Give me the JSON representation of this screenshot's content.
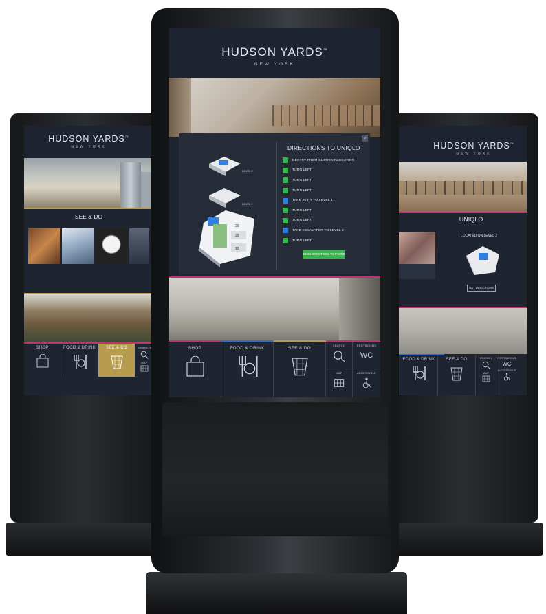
{
  "brand": {
    "title": "HUDSON YARDS",
    "trademark": "™",
    "subtitle": "NEW YORK"
  },
  "left_kiosk": {
    "section_title": "SEE & DO",
    "thumbs": [
      "",
      "",
      "",
      ""
    ],
    "nav": [
      {
        "label": "SHOP",
        "icon": "shopping-bag-icon"
      },
      {
        "label": "FOOD & DRINK",
        "icon": "fork-knife-icon"
      },
      {
        "label": "SEE & DO",
        "icon": "vessel-icon",
        "active": true
      },
      {
        "label": "SEARCH",
        "icon": "search-icon"
      },
      {
        "label": "MAP",
        "icon": "map-icon"
      }
    ]
  },
  "center_kiosk": {
    "directions": {
      "title": "DIRECTIONS TO UNIQLO",
      "close_icon": "close-icon",
      "steps": [
        {
          "text": "DEPART FROM CURRENT LOCATION",
          "color": "#38b54a"
        },
        {
          "text": "TURN LEFT",
          "color": "#38b54a"
        },
        {
          "text": "TURN LEFT",
          "color": "#38b54a"
        },
        {
          "text": "TURN LEFT",
          "color": "#38b54a"
        },
        {
          "text": "TAKE 20 HY TO LEVEL 1",
          "color": "#2f7fe0"
        },
        {
          "text": "TURN LEFT",
          "color": "#38b54a"
        },
        {
          "text": "TURN LEFT",
          "color": "#38b54a"
        },
        {
          "text": "TAKE ESCALATOR TO LEVEL 2",
          "color": "#2f7fe0"
        },
        {
          "text": "TURN LEFT",
          "color": "#38b54a"
        }
      ],
      "send_button": "SEND DIRECTIONS TO PHONE",
      "map_levels": [
        "LEVEL 2",
        "LEVEL 1"
      ],
      "map_numbers": [
        "20",
        "29",
        "15"
      ]
    },
    "nav": [
      {
        "label": "SHOP",
        "icon": "shopping-bag-icon"
      },
      {
        "label": "FOOD & DRINK",
        "icon": "fork-knife-icon"
      },
      {
        "label": "SEE & DO",
        "icon": "vessel-icon"
      },
      {
        "label": "SEARCH",
        "icon": "search-icon"
      },
      {
        "label": "RESTROOMS",
        "icon": "wc-icon",
        "text": "WC"
      },
      {
        "label": "MAP",
        "icon": "map-icon"
      },
      {
        "label": "ACCESSIBLE",
        "icon": "wheelchair-icon"
      }
    ]
  },
  "right_kiosk": {
    "store_title": "UNIQLO",
    "location": "LOCATED ON LEVEL 2",
    "get_directions": "GET DIRECTIONS",
    "nav": [
      {
        "label": "FOOD & DRINK",
        "icon": "fork-knife-icon"
      },
      {
        "label": "SEE & DO",
        "icon": "vessel-icon"
      },
      {
        "label": "SEARCH",
        "icon": "search-icon"
      },
      {
        "label": "RESTROOMS",
        "icon": "wc-icon",
        "text": "WC"
      },
      {
        "label": "MAP",
        "icon": "map-icon"
      },
      {
        "label": "ACCESSIBLE",
        "icon": "wheelchair-icon"
      }
    ]
  },
  "colors": {
    "accent_pink": "#c0336f",
    "accent_gold": "#b89c4e",
    "accent_blue": "#2e6fd0",
    "screen_bg": "#1e2430"
  }
}
